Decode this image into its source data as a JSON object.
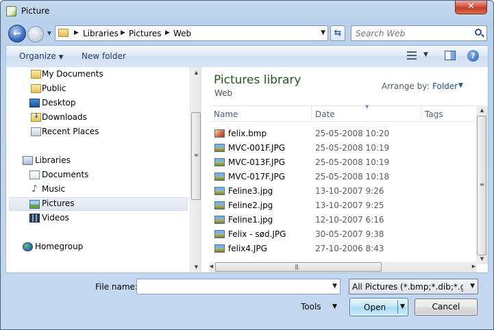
{
  "window": {
    "title": "Picture",
    "close_label": "✕"
  },
  "nav": {
    "back_label": "←",
    "forward_label": "→",
    "breadcrumbs": [
      "Libraries",
      "Pictures",
      "Web"
    ],
    "search_placeholder": "Search Web",
    "refresh_label": "⇆"
  },
  "toolbar": {
    "organize_label": "Organize",
    "new_folder_label": "New folder",
    "help_label": "?"
  },
  "sidebar": {
    "items": [
      {
        "label": "My Documents",
        "icon": "folder-icon"
      },
      {
        "label": "Public",
        "icon": "folder-icon"
      },
      {
        "label": "Desktop",
        "icon": "desktop-icon"
      },
      {
        "label": "Downloads",
        "icon": "downloads-icon"
      },
      {
        "label": "Recent Places",
        "icon": "recent-places-icon"
      },
      {
        "label": "Libraries",
        "icon": "libraries-icon"
      },
      {
        "label": "Documents",
        "icon": "documents-icon"
      },
      {
        "label": "Music",
        "icon": "music-icon"
      },
      {
        "label": "Pictures",
        "icon": "pictures-icon",
        "selected": true
      },
      {
        "label": "Videos",
        "icon": "videos-icon"
      },
      {
        "label": "Homegroup",
        "icon": "homegroup-icon"
      }
    ]
  },
  "library": {
    "title": "Pictures library",
    "subtitle": "Web",
    "arrange_by_label": "Arrange by:",
    "arrange_by_value": "Folder"
  },
  "columns": {
    "name": "Name",
    "date": "Date",
    "tags": "Tags"
  },
  "files": [
    {
      "name": "felix.bmp",
      "date": "25-05-2008 10:20",
      "type": "bmp"
    },
    {
      "name": "MVC-001F.JPG",
      "date": "25-05-2008 10:19",
      "type": "jpg"
    },
    {
      "name": "MVC-013F.JPG",
      "date": "25-05-2008 10:19",
      "type": "jpg"
    },
    {
      "name": "MVC-017F.JPG",
      "date": "25-05-2008 10:18",
      "type": "jpg"
    },
    {
      "name": "Feline3.jpg",
      "date": "13-10-2007 9:26",
      "type": "jpg"
    },
    {
      "name": "Feline2.jpg",
      "date": "13-10-2007 9:25",
      "type": "jpg"
    },
    {
      "name": "Feline1.jpg",
      "date": "12-10-2007 6:16",
      "type": "jpg"
    },
    {
      "name": "Felix - sød.JPG",
      "date": "30-05-2007 9:38",
      "type": "jpg"
    },
    {
      "name": "felix4.JPG",
      "date": "27-10-2006 8:43",
      "type": "jpg"
    }
  ],
  "footer": {
    "file_name_label": "File name:",
    "file_name_value": "",
    "filter_value": "All Pictures (*.bmp;*.dib;*.gif;*.",
    "tools_label": "Tools",
    "open_label": "Open",
    "cancel_label": "Cancel"
  }
}
